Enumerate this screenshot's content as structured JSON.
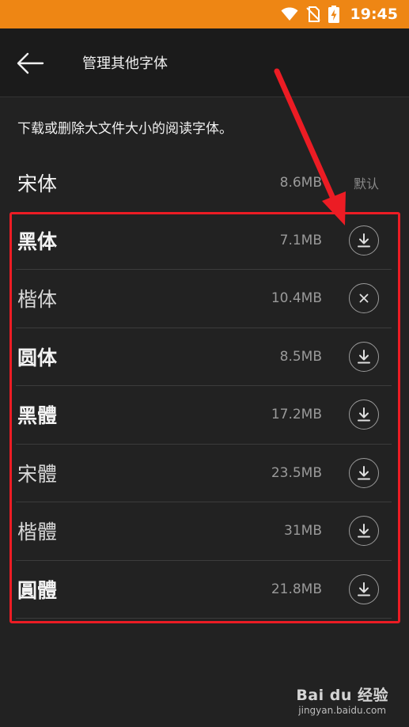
{
  "status_bar": {
    "time": "19:45",
    "icons": [
      "wifi-icon",
      "no-sim-icon",
      "battery-charging-icon"
    ],
    "background_color": "#ee8614"
  },
  "app_bar": {
    "title": "管理其他字体",
    "back_icon": "back-arrow-icon"
  },
  "description": "下载或删除大文件大小的阅读字体。",
  "fonts": [
    {
      "name": "宋体",
      "size": "8.6MB",
      "status": "默认"
    },
    {
      "name": "黑体",
      "size": "7.1MB",
      "action_icon": "download-icon"
    },
    {
      "name": "楷体",
      "size": "10.4MB",
      "action_icon": "cancel-icon"
    },
    {
      "name": "圆体",
      "size": "8.5MB",
      "action_icon": "download-icon"
    },
    {
      "name": "黑體",
      "size": "17.2MB",
      "action_icon": "download-icon"
    },
    {
      "name": "宋體",
      "size": "23.5MB",
      "action_icon": "download-icon"
    },
    {
      "name": "楷體",
      "size": "31MB",
      "action_icon": "download-icon"
    },
    {
      "name": "圓體",
      "size": "21.8MB",
      "action_icon": "download-icon"
    }
  ],
  "annotation": {
    "color": "#ec1c24"
  },
  "watermark": {
    "logo": "Bai du 经验",
    "url": "jingyan.baidu.com"
  }
}
